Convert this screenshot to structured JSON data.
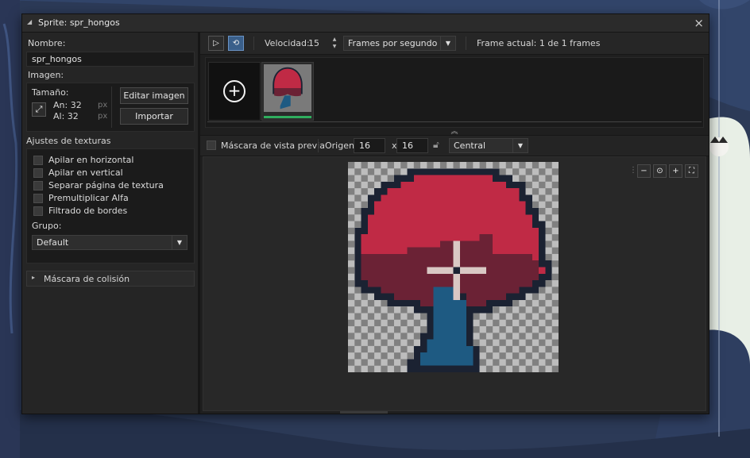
{
  "window": {
    "title": "Sprite: spr_hongos"
  },
  "left": {
    "name_label": "Nombre:",
    "name_value": "spr_hongos",
    "image_label": "Imagen:",
    "size_label": "Tamaño:",
    "width_label": "An: 32",
    "height_label": "Al: 32",
    "px_unit": "px",
    "edit_image": "Editar imagen",
    "import": "Importar",
    "texture_settings": "Ajustes de texturas",
    "options": [
      "Apilar en horizontal",
      "Apilar en vertical",
      "Separar página de textura",
      "Premultiplicar Alfa",
      "Filtrado de bordes"
    ],
    "group_label": "Grupo:",
    "group_value": "Default",
    "collision_mask": "Máscara de colisión"
  },
  "toolbar": {
    "speed_label": "Velocidad:",
    "speed_value": "15",
    "speed_unit": "Frames por segundo",
    "current_frame": "Frame actual: 1 de 1 frames"
  },
  "toolbar2": {
    "preview_mask": "Máscara de vista previa",
    "origin_label": "Origen:",
    "origin_x": "16",
    "x_sep": "x",
    "origin_y": "16",
    "origin_preset": "Central"
  },
  "colors": {
    "accent_green": "#2fae5e",
    "cap_red": "#c02a45",
    "cap_dark": "#6b2235",
    "stem_blue": "#1e5a82",
    "outline": "#1b2232"
  }
}
